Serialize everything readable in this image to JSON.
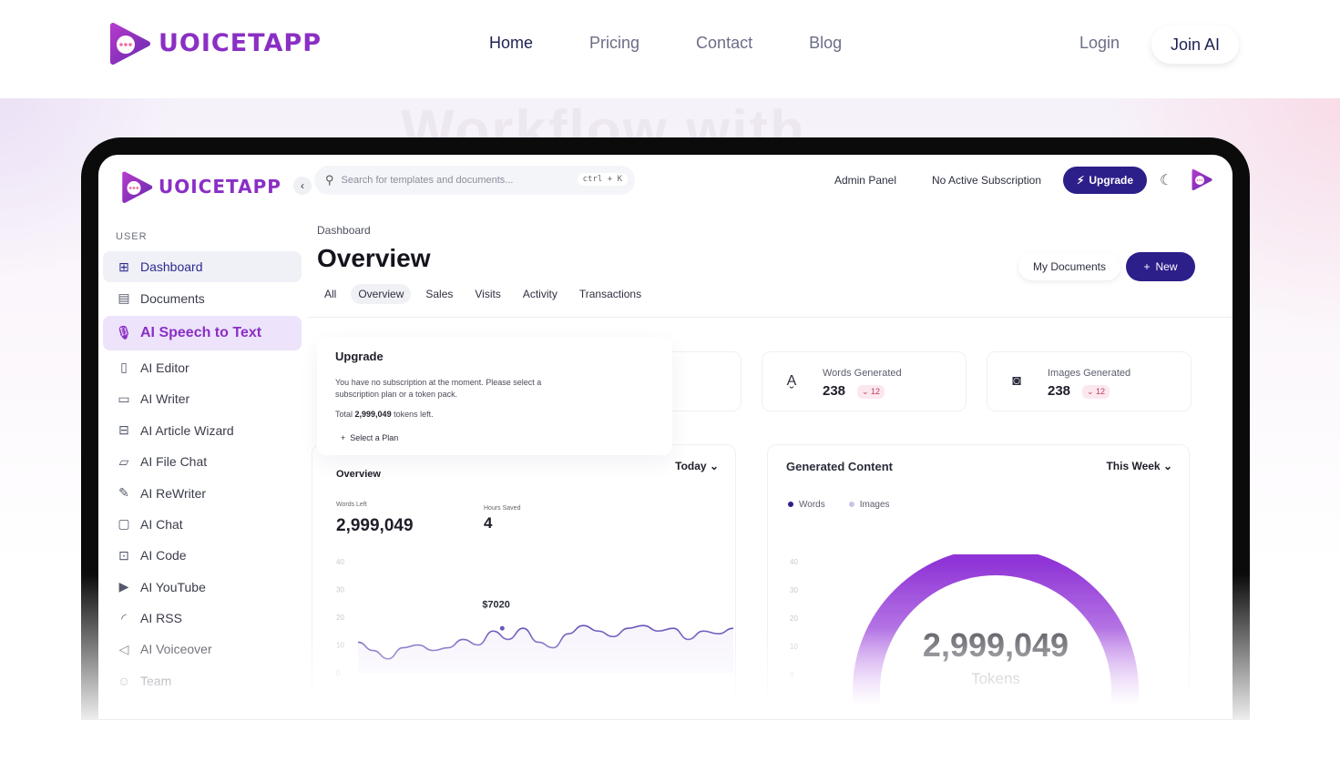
{
  "site": {
    "brand": "UOICETAPP",
    "nav": [
      "Home",
      "Pricing",
      "Contact",
      "Blog"
    ],
    "login": "Login",
    "join": "Join AI",
    "hero_ghost": "Workflow with"
  },
  "app": {
    "brand": "UOICETAPP",
    "collapse_icon": "chevron-left-icon",
    "search": {
      "placeholder": "Search for templates and documents...",
      "shortcut": "ctrl + K"
    },
    "admin_panel": "Admin Panel",
    "subscription": "No Active Subscription",
    "upgrade": "Upgrade",
    "sidebar": {
      "section": "USER",
      "items": [
        {
          "label": "Dashboard",
          "icon": "grid-icon"
        },
        {
          "label": "Documents",
          "icon": "archive-icon"
        },
        {
          "label": "AI Speech to Text",
          "icon": "microphone-icon"
        },
        {
          "label": "AI Editor",
          "icon": "book-icon"
        },
        {
          "label": "AI Writer",
          "icon": "document-icon"
        },
        {
          "label": "AI Article Wizard",
          "icon": "article-icon"
        },
        {
          "label": "AI File Chat",
          "icon": "file-chat-icon"
        },
        {
          "label": "AI ReWriter",
          "icon": "pen-icon"
        },
        {
          "label": "AI Chat",
          "icon": "chat-icon"
        },
        {
          "label": "AI Code",
          "icon": "terminal-icon"
        },
        {
          "label": "AI YouTube",
          "icon": "play-icon"
        },
        {
          "label": "AI RSS",
          "icon": "rss-icon"
        },
        {
          "label": "AI Voiceover",
          "icon": "speaker-icon"
        },
        {
          "label": "Team",
          "icon": "user-icon"
        }
      ]
    },
    "main": {
      "breadcrumb": "Dashboard",
      "title": "Overview",
      "tabs": [
        "All",
        "Overview",
        "Sales",
        "Visits",
        "Activity",
        "Transactions"
      ],
      "my_documents": "My Documents",
      "new": "New",
      "upgrade_card": {
        "title": "Upgrade",
        "text": "You have no subscription at the moment. Please select a subscription plan or a token pack.",
        "total_prefix": "Total",
        "total_value": "2,999,049",
        "total_suffix": "tokens left.",
        "select_plan": "Select a Plan"
      },
      "stats": [
        {
          "label": "Words Generated",
          "value": "238",
          "delta": "12",
          "icon": "spell-check-icon"
        },
        {
          "label": "Images Generated",
          "value": "238",
          "delta": "12",
          "icon": "camera-icon"
        }
      ],
      "overview_card": {
        "title": "Overview",
        "period": "Today",
        "words_left_label": "Words Left",
        "words_left": "2,999,049",
        "hours_saved_label": "Hours Saved",
        "hours_saved": "4",
        "tooltip": "$7020"
      },
      "generated_card": {
        "title": "Generated Content",
        "period": "This Week",
        "legend": [
          "Words",
          "Images"
        ],
        "gauge_value": "2,999,049",
        "gauge_unit": "Tokens"
      }
    }
  },
  "colors": {
    "brand_purple": "#8a2fc4",
    "deep_indigo": "#2d1f8a",
    "nav_active": "#1d2150"
  },
  "chart_data": [
    {
      "type": "line",
      "title": "Overview",
      "y_ticks": [
        "40",
        "30",
        "20",
        "10",
        "0"
      ],
      "ylim": [
        0,
        40
      ],
      "values": [
        11,
        8,
        5,
        9,
        10,
        8,
        9,
        12,
        10,
        15,
        12,
        16,
        11,
        9,
        14,
        17,
        15,
        13,
        16,
        17,
        15,
        16,
        12,
        15,
        14,
        16
      ],
      "annotation": "$7020"
    },
    {
      "type": "gauge",
      "title": "Generated Content",
      "legend": [
        "Words",
        "Images"
      ],
      "y_ticks": [
        "40",
        "30",
        "20",
        "10",
        "0"
      ],
      "value": "2,999,049",
      "unit": "Tokens"
    }
  ]
}
